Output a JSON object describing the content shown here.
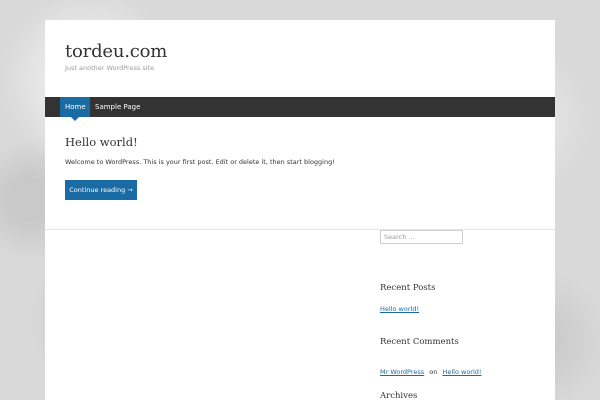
{
  "header": {
    "site_title": "tordeu.com",
    "tagline": "Just another WordPress site"
  },
  "nav": {
    "items": [
      {
        "label": "Home",
        "active": true
      },
      {
        "label": "Sample Page",
        "active": false
      }
    ]
  },
  "post": {
    "title": "Hello world!",
    "excerpt": "Welcome to WordPress. This is your first post. Edit or delete it, then start blogging!",
    "more_label": "Continue reading →"
  },
  "sidebar": {
    "search_placeholder": "Search …",
    "recent_posts": {
      "title": "Recent Posts",
      "items": [
        "Hello world!"
      ]
    },
    "recent_comments": {
      "title": "Recent Comments",
      "author": "Mr WordPress",
      "on": "on",
      "post": "Hello world!"
    },
    "archives": {
      "title": "Archives"
    }
  },
  "colors": {
    "accent": "#1a6ba3",
    "navbar": "#333333",
    "text": "#333333"
  }
}
